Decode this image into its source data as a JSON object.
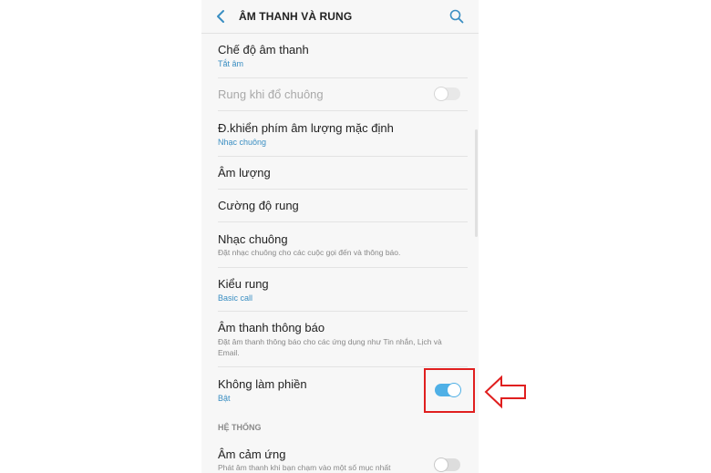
{
  "header": {
    "title": "ÂM THANH VÀ RUNG",
    "back_icon": "chevron-left-icon",
    "search_icon": "search-icon"
  },
  "settings": {
    "sound_mode": {
      "title": "Chế độ âm thanh",
      "value": "Tắt âm"
    },
    "vibrate_on_ring": {
      "title": "Rung khi đổ chuông",
      "toggle": "off",
      "enabled": false
    },
    "volume_keys": {
      "title": "Đ.khiển phím âm lượng mặc định",
      "value": "Nhạc chuông"
    },
    "volume": {
      "title": "Âm lượng"
    },
    "vibration_intensity": {
      "title": "Cường độ rung"
    },
    "ringtone": {
      "title": "Nhạc chuông",
      "description": "Đặt nhạc chuông cho các cuộc gọi đến và thông báo."
    },
    "vibration_pattern": {
      "title": "Kiểu rung",
      "value": "Basic call"
    },
    "notification_sounds": {
      "title": "Âm thanh thông báo",
      "description": "Đặt âm thanh thông báo cho các ứng dụng như Tin nhắn, Lịch và Email."
    },
    "do_not_disturb": {
      "title": "Không làm phiền",
      "value": "Bật",
      "toggle": "on"
    },
    "system_section": {
      "label": "HỆ THỐNG"
    },
    "touch_sounds": {
      "title": "Âm cảm ứng",
      "description": "Phát âm thanh khi bạn chạm vào một số mục nhất",
      "toggle": "off"
    }
  },
  "colors": {
    "accent": "#3a8ec2",
    "toggle_on": "#4fb0e6",
    "annotation": "#e01f1f"
  }
}
